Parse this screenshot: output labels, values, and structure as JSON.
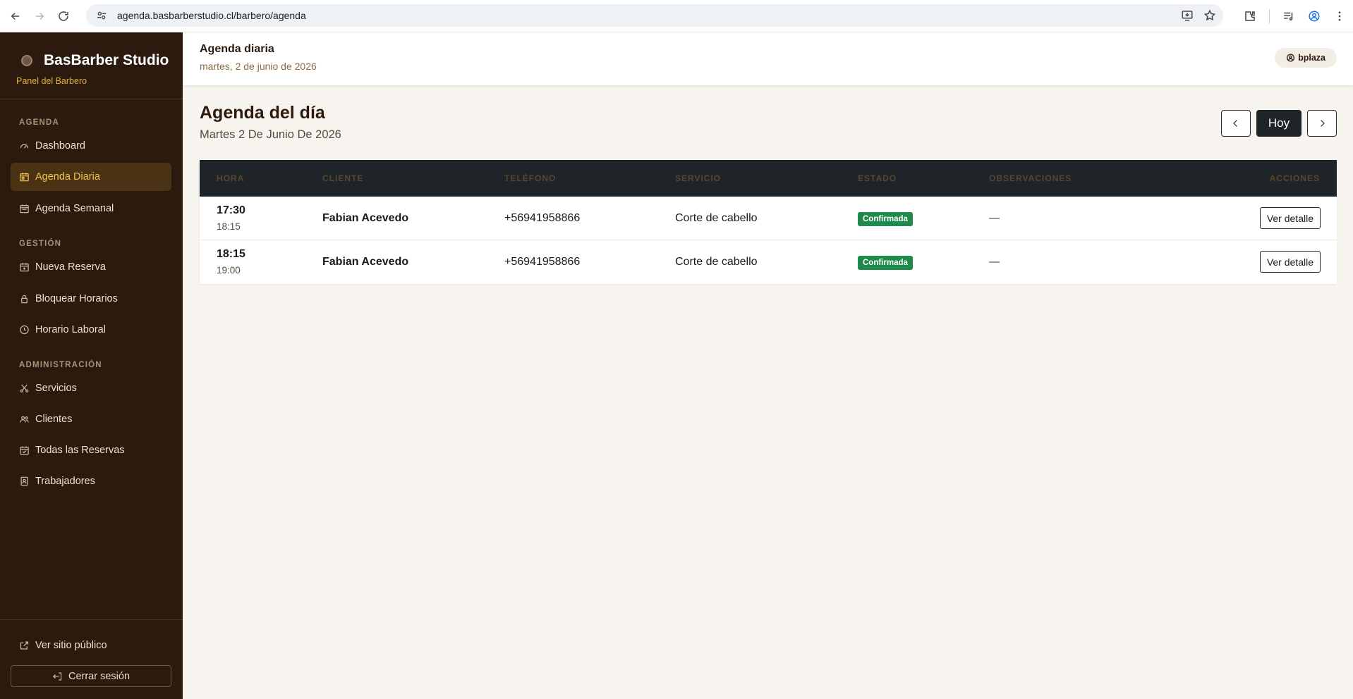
{
  "browser": {
    "url": "agenda.basbarberstudio.cl/barbero/agenda"
  },
  "sidebar": {
    "brand_name": "BasBarber Studio",
    "brand_sub": "Panel del Barbero",
    "sections": [
      {
        "label": "AGENDA"
      },
      {
        "label": "GESTIÓN"
      },
      {
        "label": "ADMINISTRACIÓN"
      }
    ],
    "items": [
      {
        "label": "Dashboard",
        "icon": "gauge-icon"
      },
      {
        "label": "Agenda Diaria",
        "icon": "calendar-day-icon",
        "active": true
      },
      {
        "label": "Agenda Semanal",
        "icon": "calendar-week-icon"
      },
      {
        "label": "Nueva Reserva",
        "icon": "calendar-plus-icon"
      },
      {
        "label": "Bloquear Horarios",
        "icon": "lock-icon"
      },
      {
        "label": "Horario Laboral",
        "icon": "clock-icon"
      },
      {
        "label": "Servicios",
        "icon": "scissors-icon"
      },
      {
        "label": "Clientes",
        "icon": "people-icon"
      },
      {
        "label": "Todas las Reservas",
        "icon": "calendar-check-icon"
      },
      {
        "label": "Trabajadores",
        "icon": "badge-icon"
      }
    ],
    "public_site": "Ver sitio público",
    "logout": "Cerrar sesión"
  },
  "header": {
    "title": "Agenda diaria",
    "date": "martes, 2 de junio de 2026",
    "user": "bplaza"
  },
  "main": {
    "title": "Agenda del día",
    "subtitle": "Martes 2 De Junio De 2026",
    "today_label": "Hoy",
    "columns": [
      "HORA",
      "CLIENTE",
      "TELÉFONO",
      "SERVICIO",
      "ESTADO",
      "OBSERVACIONES",
      "ACCIONES"
    ],
    "rows": [
      {
        "start": "17:30",
        "end": "18:15",
        "client": "Fabian Acevedo",
        "phone": "+56941958866",
        "service": "Corte de cabello",
        "status": "Confirmada",
        "notes": "—",
        "action": "Ver detalle"
      },
      {
        "start": "18:15",
        "end": "19:00",
        "client": "Fabian Acevedo",
        "phone": "+56941958866",
        "service": "Corte de cabello",
        "status": "Confirmada",
        "notes": "—",
        "action": "Ver detalle"
      }
    ]
  },
  "colors": {
    "sidebar_bg": "#2b1a0d",
    "accent": "#f2c14e",
    "status_confirmed": "#1e8a4c",
    "table_header": "#1f2428"
  }
}
